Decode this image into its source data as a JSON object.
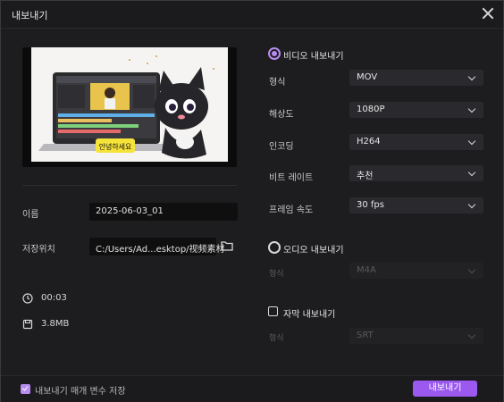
{
  "window": {
    "title": "내보내기"
  },
  "left": {
    "name_label": "이름",
    "name_value": "2025-06-03_01",
    "location_label": "저장위치",
    "location_value": "C:/Users/Ad...esktop/视频素材",
    "duration": "00:03",
    "size": "3.8MB",
    "preview_caption": "안녕하세요"
  },
  "right": {
    "video_section": "비디오 내보내기",
    "rows": [
      {
        "label": "형식",
        "value": "MOV"
      },
      {
        "label": "해상도",
        "value": "1080P"
      },
      {
        "label": "인코딩",
        "value": "H264"
      },
      {
        "label": "비트 레이트",
        "value": "추천"
      },
      {
        "label": "프레임 속도",
        "value": "30  fps"
      }
    ],
    "audio_section": "오디오 내보내기",
    "audio_row": {
      "label": "형식",
      "value": "M4A"
    },
    "subtitle_section": "자막 내보내기",
    "subtitle_row": {
      "label": "형식",
      "value": "SRT"
    }
  },
  "footer": {
    "remember_label": "내보내기 매개 변수 저장",
    "export_button": "내보내기"
  },
  "colors": {
    "accent": "#9b59f0",
    "accent_light": "#b88cf1"
  }
}
